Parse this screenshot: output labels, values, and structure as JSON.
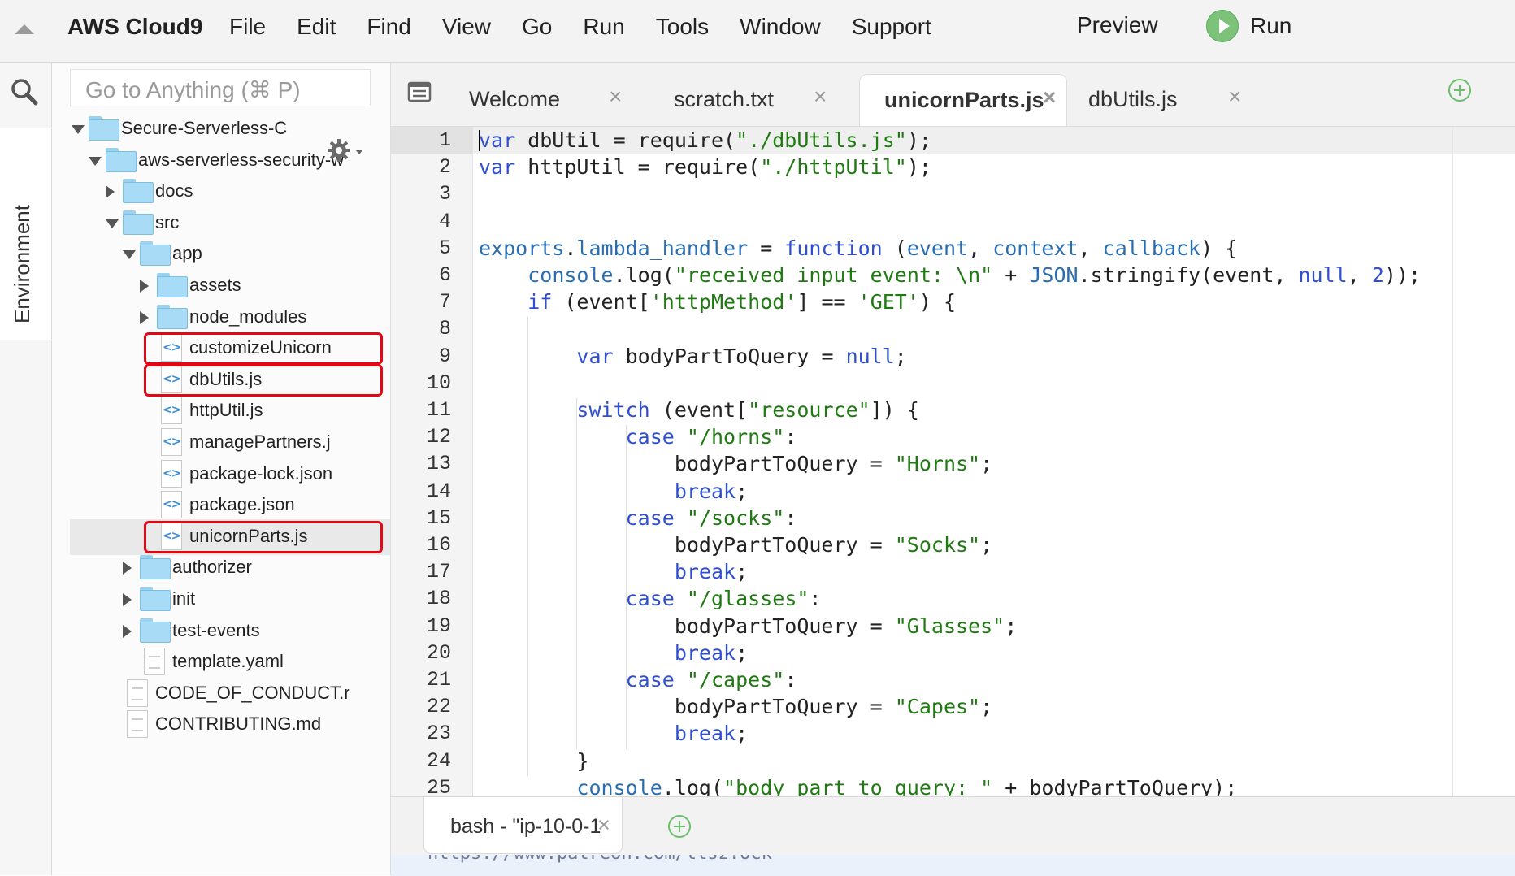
{
  "app": {
    "brand": "AWS Cloud9",
    "menu": [
      "File",
      "Edit",
      "Find",
      "View",
      "Go",
      "Run",
      "Tools",
      "Window",
      "Support"
    ],
    "preview_label": "Preview",
    "run_label": "Run"
  },
  "sidebar": {
    "goto_placeholder": "Go to Anything (⌘ P)",
    "environment_tab_label": "Environment"
  },
  "tree": [
    {
      "label": "Secure-Serverless-C",
      "type": "folder",
      "open": true,
      "depth": 0
    },
    {
      "label": "aws-serverless-security-w",
      "type": "folder",
      "open": true,
      "depth": 1
    },
    {
      "label": "docs",
      "type": "folder",
      "open": false,
      "depth": 2
    },
    {
      "label": "src",
      "type": "folder",
      "open": true,
      "depth": 2
    },
    {
      "label": "app",
      "type": "folder",
      "open": true,
      "depth": 3
    },
    {
      "label": "assets",
      "type": "folder",
      "open": false,
      "depth": 4
    },
    {
      "label": "node_modules",
      "type": "folder",
      "open": false,
      "depth": 4
    },
    {
      "label": "customizeUnicorn",
      "type": "js",
      "depth": 4,
      "highlighted": true
    },
    {
      "label": "dbUtils.js",
      "type": "js",
      "depth": 4,
      "highlighted": true
    },
    {
      "label": "httpUtil.js",
      "type": "js",
      "depth": 4
    },
    {
      "label": "managePartners.j",
      "type": "js",
      "depth": 4
    },
    {
      "label": "package-lock.json",
      "type": "js",
      "depth": 4
    },
    {
      "label": "package.json",
      "type": "js",
      "depth": 4
    },
    {
      "label": "unicornParts.js",
      "type": "js",
      "depth": 4,
      "highlighted": true,
      "selected": true
    },
    {
      "label": "authorizer",
      "type": "folder",
      "open": false,
      "depth": 3
    },
    {
      "label": "init",
      "type": "folder",
      "open": false,
      "depth": 3
    },
    {
      "label": "test-events",
      "type": "folder",
      "open": false,
      "depth": 3
    },
    {
      "label": "template.yaml",
      "type": "doc",
      "depth": 3
    },
    {
      "label": "CODE_OF_CONDUCT.r",
      "type": "doc",
      "depth": 2
    },
    {
      "label": "CONTRIBUTING.md",
      "type": "doc",
      "depth": 2
    }
  ],
  "tabs": [
    {
      "label": "Welcome",
      "active": false
    },
    {
      "label": "scratch.txt",
      "active": false
    },
    {
      "label": "unicornParts.js",
      "active": true
    },
    {
      "label": "dbUtils.js",
      "active": false
    }
  ],
  "tab_close_glyph": "×",
  "editor": {
    "lines": [
      "var dbUtil = require(\"./dbUtils.js\");",
      "var httpUtil = require(\"./httpUtil\");",
      "",
      "",
      "exports.lambda_handler = function (event, context, callback) {",
      "    console.log(\"received input event: \\n\" + JSON.stringify(event, null, 2));",
      "    if (event['httpMethod'] == 'GET') {",
      "",
      "        var bodyPartToQuery = null;",
      "",
      "        switch (event[\"resource\"]) {",
      "            case \"/horns\":",
      "                bodyPartToQuery = \"Horns\";",
      "                break;",
      "            case \"/socks\":",
      "                bodyPartToQuery = \"Socks\";",
      "                break;",
      "            case \"/glasses\":",
      "                bodyPartToQuery = \"Glasses\";",
      "                break;",
      "            case \"/capes\":",
      "                bodyPartToQuery = \"Capes\";",
      "                break;",
      "        }",
      "        console.log(\"body part to query: \" + bodyPartToQuery);"
    ]
  },
  "terminal": {
    "tab_label": "bash - \"ip-10-0-1",
    "close_glyph": "×",
    "output_fragment": "https://www.patreon.com/ttsz?ock"
  },
  "colors": {
    "keyword": "#2f4fd0",
    "string": "#1f7a12",
    "identifier": "#2a6db0",
    "highlight_box": "#e30613",
    "run_green": "#7cc27a",
    "folder": "#a8dbf5"
  }
}
